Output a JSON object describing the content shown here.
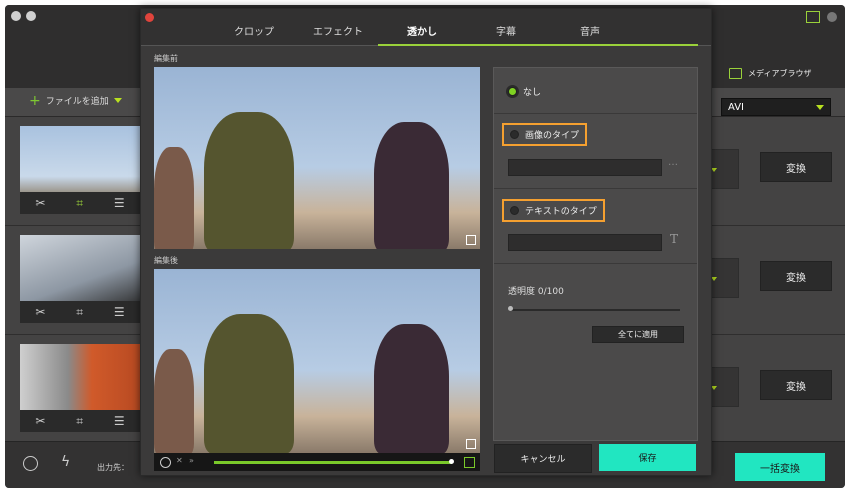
{
  "sidebar": {
    "add_file": "ファイルを追加"
  },
  "media": {
    "label": "メディアブラウザ"
  },
  "format": {
    "value": "AVI"
  },
  "rows": [
    {
      "convert": "変換"
    },
    {
      "convert": "変換"
    },
    {
      "convert": "変換"
    }
  ],
  "footer": {
    "output_label": "出力先：",
    "batch_convert": "一括変換"
  },
  "tabs": [
    {
      "label": "クロップ"
    },
    {
      "label": "エフェクト"
    },
    {
      "label": "透かし"
    },
    {
      "label": "字幕"
    },
    {
      "label": "音声"
    }
  ],
  "editor": {
    "before_label": "編集前",
    "after_label": "編集後"
  },
  "watermark": {
    "none": "なし",
    "image_type": "画像のタイプ",
    "text_type": "テキストのタイプ",
    "opacity": "透明度 0/100",
    "apply_all": "全てに適用",
    "opacity_value": 0
  },
  "dialog": {
    "cancel": "キャンセル",
    "save": "保存"
  },
  "colors": {
    "accent": "#21e6c1",
    "selected": "#7fd322",
    "highlight": "#f5a030"
  }
}
